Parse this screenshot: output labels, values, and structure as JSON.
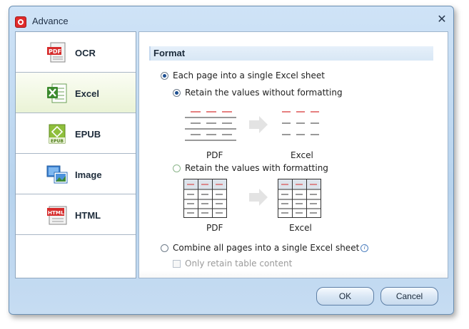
{
  "window": {
    "title": "Advance",
    "close_glyph": "✕"
  },
  "sidebar": {
    "items": [
      {
        "label": "OCR",
        "icon": "pdf-ocr-icon",
        "active": false
      },
      {
        "label": "Excel",
        "icon": "excel-icon",
        "active": true
      },
      {
        "label": "EPUB",
        "icon": "epub-icon",
        "active": false
      },
      {
        "label": "Image",
        "icon": "image-icon",
        "active": false
      },
      {
        "label": "HTML",
        "icon": "html-icon",
        "active": false
      }
    ]
  },
  "panel": {
    "section_title": "Format",
    "opt_each_page": "Each page into a single Excel sheet",
    "opt_retain_without": "Retain the values without formatting",
    "opt_retain_with": "Retain the values with formatting",
    "opt_combine": "Combine all pages into a single Excel sheet",
    "opt_only_table": "Only retain table content",
    "caption_pdf": "PDF",
    "caption_excel": "Excel",
    "badge_pdf": "PDF",
    "badge_epub": "EPUB",
    "badge_html": "HTML",
    "info_glyph": "i"
  },
  "buttons": {
    "ok": "OK",
    "cancel": "Cancel"
  },
  "colors": {
    "accent_red": "#d62b2b",
    "excel_green": "#3c8a2e",
    "radio_blue": "#1d4f91"
  }
}
